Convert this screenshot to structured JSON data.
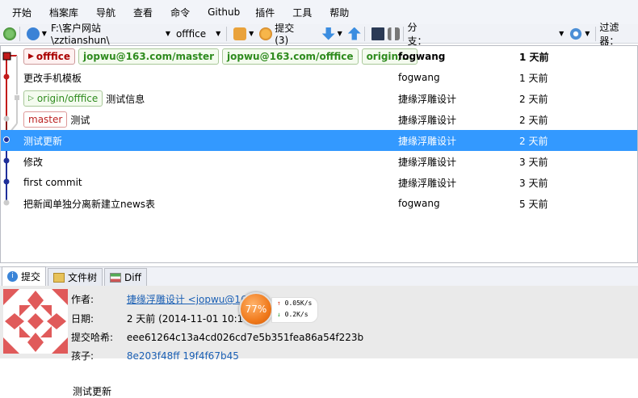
{
  "menu": [
    "开始",
    "档案库",
    "导航",
    "查看",
    "命令",
    "Github",
    "插件",
    "工具",
    "帮助"
  ],
  "toolbar": {
    "path": "F:\\客户网站\\zztianshun\\",
    "branch": "offfice",
    "commit_label": "提交 (3)",
    "branch_label": "分支：",
    "filter_label": "过滤器："
  },
  "commits": [
    {
      "refs": [
        {
          "text": "offfice",
          "kind": "cur"
        },
        {
          "text": "jopwu@163.com/master",
          "kind": "green"
        },
        {
          "text": "jopwu@163.com/offfice",
          "kind": "green"
        },
        {
          "text": "origin/...",
          "kind": "green"
        }
      ],
      "message": "",
      "author": "fogwang",
      "date": "1 天前",
      "bold": true
    },
    {
      "refs": [],
      "message": "更改手机模板",
      "author": "fogwang",
      "date": "1 天前"
    },
    {
      "refs": [
        {
          "text": "origin/offfice",
          "kind": "greenarrow"
        }
      ],
      "message": "测试信息",
      "author": "捷缘浮雕设计",
      "date": "2 天前"
    },
    {
      "refs": [
        {
          "text": "master",
          "kind": "red"
        }
      ],
      "message": "测试",
      "author": "捷缘浮雕设计",
      "date": "2 天前"
    },
    {
      "refs": [],
      "message": "测试更新",
      "author": "捷缘浮雕设计",
      "date": "2 天前",
      "selected": true
    },
    {
      "refs": [],
      "message": "修改",
      "author": "捷缘浮雕设计",
      "date": "3 天前"
    },
    {
      "refs": [],
      "message": "first commit",
      "author": "捷缘浮雕设计",
      "date": "3 天前"
    },
    {
      "refs": [],
      "message": "把新闻单独分离新建立news表",
      "author": "fogwang",
      "date": "5 天前"
    }
  ],
  "tabs": [
    "提交",
    "文件树",
    "Diff"
  ],
  "detail": {
    "author_label": "作者:",
    "author_value": "捷缘浮雕设计 <jopwu@16",
    "date_label": "日期:",
    "date_value": "2 天前 (2014-11-01 10:16",
    "hash_label": "提交哈希:",
    "hash_value": "eee61264c13a4cd026cd7e5b351fea86a54f223b",
    "children_label": "孩子:",
    "children_value": "8e203f48ff 19f4f67b45",
    "message": "测试更新"
  },
  "speed": {
    "percent": "77%",
    "up": "0.05K/s",
    "down": "0.2K/s"
  }
}
